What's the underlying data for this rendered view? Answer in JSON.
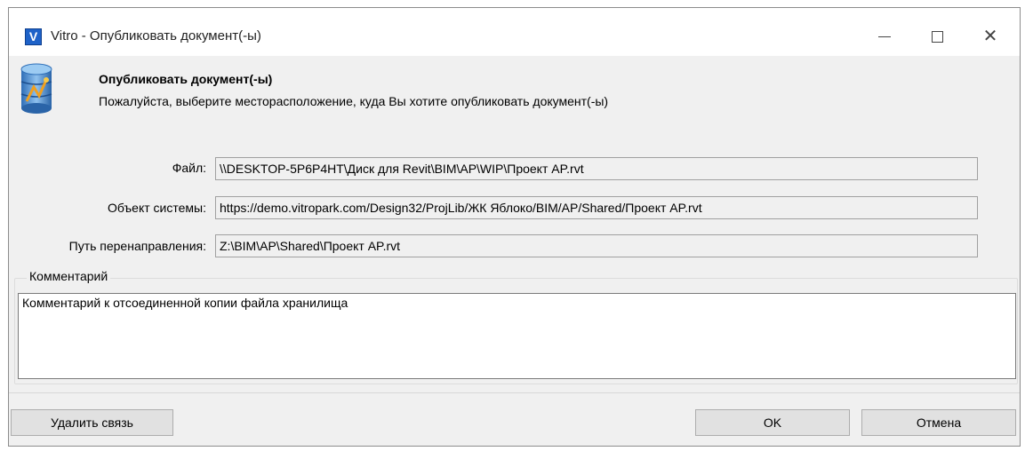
{
  "window": {
    "app_icon_letter": "V",
    "title": "Vitro - Опубликовать документ(-ы)"
  },
  "header": {
    "icon": "database-publish-icon",
    "title": "Опубликовать документ(-ы)",
    "subtitle": "Пожалуйста, выберите месторасположение, куда Вы хотите опубликовать документ(-ы)"
  },
  "fields": {
    "file_label": "Файл:",
    "file_value": "\\\\DESKTOP-5P6P4HT\\Диск для Revit\\BIM\\AP\\WIP\\Проект AP.rvt",
    "object_label": "Объект системы:",
    "object_value": "https://demo.vitropark.com/Design32/ProjLib/ЖК Яблоко/BIM/AP/Shared/Проект AP.rvt",
    "redirect_label": "Путь перенаправления:",
    "redirect_value": "Z:\\BIM\\AP\\Shared\\Проект AP.rvt"
  },
  "comment": {
    "legend": "Комментарий",
    "text": "Комментарий к отсоединенной копии файла хранилища"
  },
  "buttons": {
    "unlink": "Удалить связь",
    "ok": "OK",
    "cancel": "Отмена"
  }
}
